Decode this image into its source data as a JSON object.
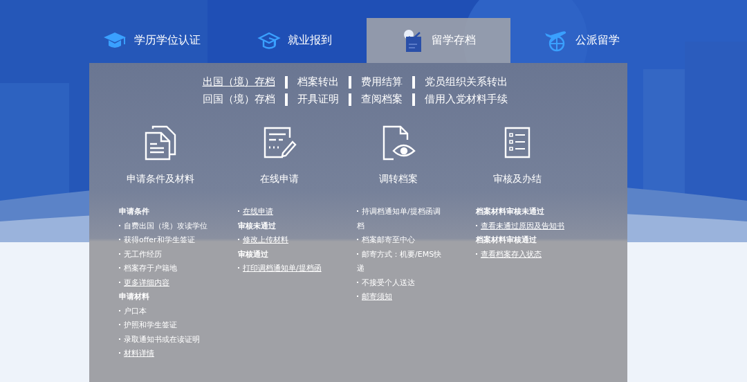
{
  "tabs": [
    {
      "label": "学历学位认证",
      "selected": false
    },
    {
      "label": "就业报到",
      "selected": false
    },
    {
      "label": "留学存档",
      "selected": true
    },
    {
      "label": "公派留学",
      "selected": false
    }
  ],
  "nav_rows": [
    [
      {
        "label": "出国（境）存档",
        "selected": true
      },
      {
        "label": "档案转出",
        "selected": false
      },
      {
        "label": "费用结算",
        "selected": false
      },
      {
        "label": "党员组织关系转出",
        "selected": false
      }
    ],
    [
      {
        "label": "回国（境）存档",
        "selected": false
      },
      {
        "label": "开具证明",
        "selected": false
      },
      {
        "label": "查阅档案",
        "selected": false
      },
      {
        "label": "借用入党材料手续",
        "selected": false
      }
    ]
  ],
  "steps": [
    {
      "label": "申请条件及材料",
      "items": [
        {
          "kind": "heading",
          "text": "申请条件"
        },
        {
          "kind": "item",
          "text": "自费出国（境）攻读学位"
        },
        {
          "kind": "item",
          "text": "获得offer和学生签证"
        },
        {
          "kind": "item",
          "text": "无工作经历"
        },
        {
          "kind": "item",
          "text": "档案存于户籍地"
        },
        {
          "kind": "link",
          "text": "更多详细内容"
        },
        {
          "kind": "heading",
          "text": "申请材料"
        },
        {
          "kind": "item",
          "text": "户口本"
        },
        {
          "kind": "item",
          "text": "护照和学生签证"
        },
        {
          "kind": "item",
          "text": "录取通知书或在读证明"
        },
        {
          "kind": "link",
          "text": "材料详情"
        }
      ]
    },
    {
      "label": "在线申请",
      "items": [
        {
          "kind": "link",
          "text": "在线申请"
        },
        {
          "kind": "heading",
          "text": "审核未通过"
        },
        {
          "kind": "link",
          "text": "修改上传材料"
        },
        {
          "kind": "heading",
          "text": "审核通过"
        },
        {
          "kind": "link",
          "text": "打印调档通知单/提档函"
        }
      ]
    },
    {
      "label": "调转档案",
      "items": [
        {
          "kind": "item",
          "text": "持调档通知单/提档函调档"
        },
        {
          "kind": "item",
          "text": "档案邮寄至中心"
        },
        {
          "kind": "item",
          "text": "邮寄方式：机要/EMS快递"
        },
        {
          "kind": "item",
          "text": "不接受个人送达"
        },
        {
          "kind": "link",
          "text": "邮寄须知"
        }
      ]
    },
    {
      "label": "审核及办结",
      "items": [
        {
          "kind": "heading",
          "text": "档案材料审核未通过"
        },
        {
          "kind": "link",
          "text": "查看未通过原因及告知书"
        },
        {
          "kind": "heading",
          "text": "档案材料审核通过"
        },
        {
          "kind": "link",
          "text": "查看档案存入状态"
        }
      ]
    }
  ]
}
